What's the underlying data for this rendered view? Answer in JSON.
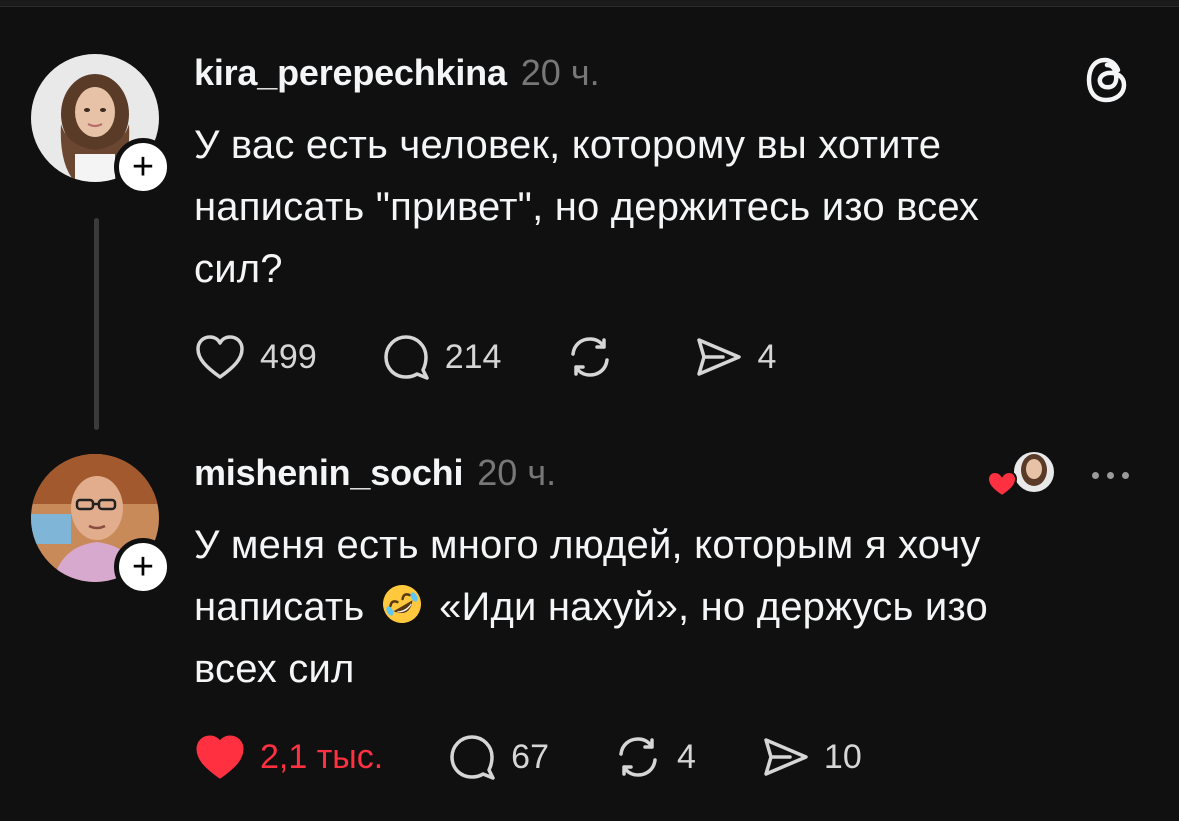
{
  "posts": [
    {
      "username": "kira_perepechkina",
      "time": "20 ч.",
      "text": "У вас есть человек, которому вы хотите\nнаписать \"привет\", но держитесь изо всех\nсил?",
      "likes": "499",
      "replies": "214",
      "reposts": "",
      "shares": "4",
      "liked": false
    },
    {
      "username": "mishenin_sochi",
      "time": "20 ч.",
      "text_line1": "У меня есть много людей, которым я хочу",
      "text_line2_a": "написать ",
      "text_line2_b": " «Иди нахуй», но держусь изо",
      "text_line3": "всех сил",
      "emoji": "rolling-on-floor-laughing",
      "likes": "2,1 тыс.",
      "replies": "67",
      "reposts": "4",
      "shares": "10",
      "liked": true
    }
  ],
  "colors": {
    "background": "#101010",
    "like_red": "#ff3040",
    "muted": "#777777"
  },
  "icons": [
    "threads-logo-icon",
    "plus-icon",
    "heart-icon",
    "comment-icon",
    "repost-icon",
    "share-icon",
    "more-icon"
  ]
}
